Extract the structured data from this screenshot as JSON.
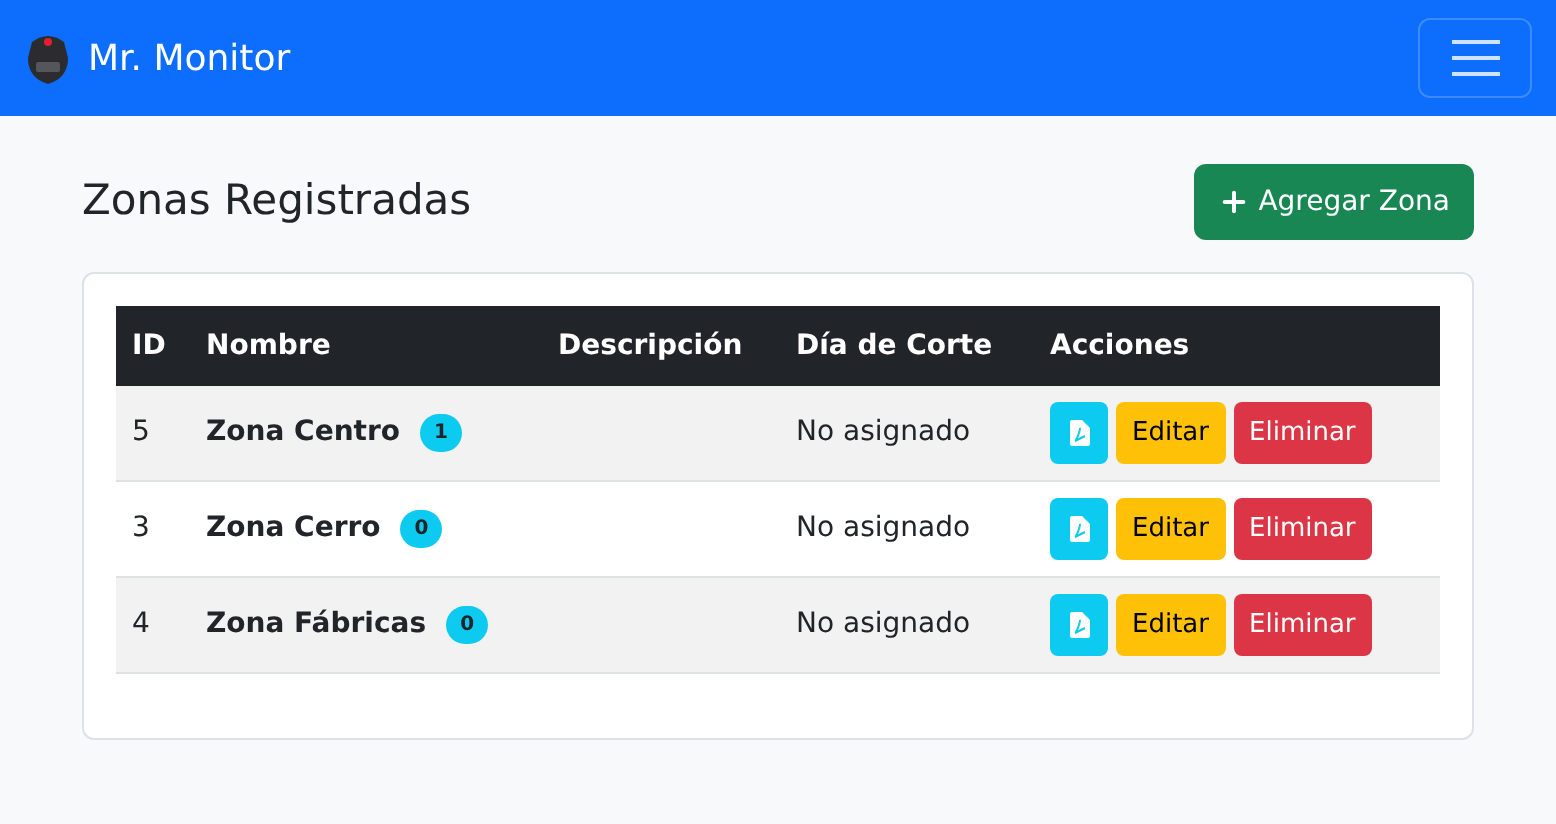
{
  "navbar": {
    "brand": "Mr. Monitor"
  },
  "page": {
    "title": "Zonas Registradas",
    "add_button": "Agregar Zona"
  },
  "table": {
    "columns": [
      "ID",
      "Nombre",
      "Descripción",
      "Día de Corte",
      "Acciones"
    ],
    "rows": [
      {
        "id": "5",
        "name": "Zona Centro",
        "count": "1",
        "description": "",
        "cutoff": "No asignado",
        "edit": "Editar",
        "delete": "Eliminar"
      },
      {
        "id": "3",
        "name": "Zona Cerro",
        "count": "0",
        "description": "",
        "cutoff": "No asignado",
        "edit": "Editar",
        "delete": "Eliminar"
      },
      {
        "id": "4",
        "name": "Zona Fábricas",
        "count": "0",
        "description": "",
        "cutoff": "No asignado",
        "edit": "Editar",
        "delete": "Eliminar"
      }
    ]
  }
}
